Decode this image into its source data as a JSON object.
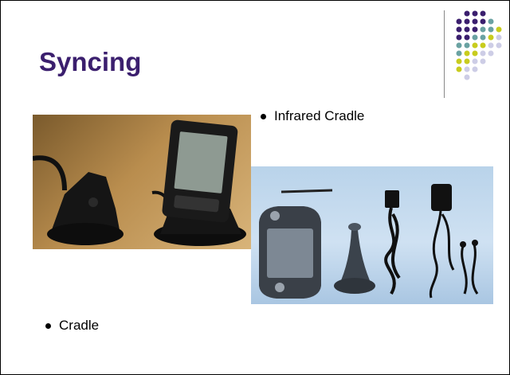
{
  "slide": {
    "title": "Syncing",
    "bullets": [
      {
        "label": "Infrared Cradle"
      },
      {
        "label": "Cradle"
      }
    ]
  },
  "photos": {
    "cradle": {
      "description_icon": "cradle-photo"
    },
    "kit": {
      "description_icon": "pda-kit-photo"
    }
  },
  "colors": {
    "title": "#3b1f6e",
    "dot_purple": "#3b1f6e",
    "dot_teal": "#6aa2a2",
    "dot_yellow": "#c8cc1e",
    "dot_lavender": "#cdcde6"
  }
}
